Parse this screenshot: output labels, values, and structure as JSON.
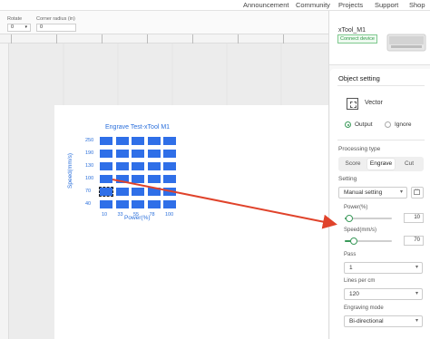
{
  "nav": {
    "announcement": "Announcement",
    "community": "Community",
    "projects": "Projects",
    "support": "Support",
    "shop": "Shop"
  },
  "toolbar": {
    "rotate_label": "Rotate",
    "rotate_value": "0",
    "corner_label": "Corner radius (in)",
    "corner_value": "0"
  },
  "canvas": {
    "test_title": "Engrave Test-xTool M1",
    "y_axis_label": "Speed(mm/s)",
    "x_axis_label": "Power(%)",
    "y_ticks": [
      "250",
      "190",
      "130",
      "100",
      "70",
      "40"
    ],
    "x_ticks": [
      "10",
      "33",
      "55",
      "78",
      "100"
    ],
    "grid_rows": 6,
    "grid_cols": 5,
    "selected_cell": {
      "row": 4,
      "col": 0
    }
  },
  "device": {
    "name": "xTool_M1",
    "status": "Connect device"
  },
  "object_setting": {
    "title": "Object setting",
    "type_label": "Vector",
    "output_label": "Output",
    "ignore_label": "Ignore",
    "selected": "Output"
  },
  "processing": {
    "title": "Processing type",
    "tabs": [
      "Score",
      "Engrave",
      "Cut"
    ],
    "active_tab": "Engrave"
  },
  "setting": {
    "title": "Setting",
    "mode_value": "Manual setting",
    "power_label": "Power(%)",
    "power_value": "10",
    "power_fraction": 0.1,
    "speed_label": "Speed(mm/s)",
    "speed_value": "70",
    "speed_fraction": 0.19,
    "pass_label": "Pass",
    "pass_value": "1",
    "lines_label": "Lines per cm",
    "lines_value": "120",
    "engraving_mode_label": "Engraving mode",
    "engraving_mode_value": "Bi-directional"
  },
  "colors": {
    "accent": "#3a9a5a",
    "test_blue": "#2f6fe8",
    "arrow": "#e0432b"
  }
}
